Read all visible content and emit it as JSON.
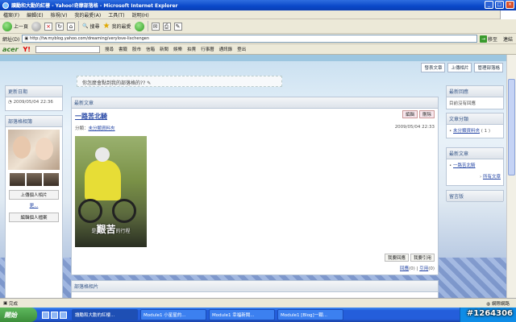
{
  "window": {
    "title": "讀勵和大勳的紅樓 - Yahoo!奇摩部落格 - Microsoft Internet Explorer",
    "min": "_",
    "max": "□",
    "close": "×"
  },
  "menu": [
    "檔案(F)",
    "編輯(E)",
    "檢視(V)",
    "我的最愛(A)",
    "工具(T)",
    "說明(H)"
  ],
  "toolbar": {
    "back": "上一頁",
    "search": "搜尋",
    "favorites": "我的最愛"
  },
  "address": {
    "label": "網址(D)",
    "url": "http://tw.myblog.yahoo.com/dreaming/verylove-lixchengen",
    "go": "移至",
    "links": "連結"
  },
  "ytoolbar": {
    "brand": "acer",
    "yahoo": "Y!",
    "items": [
      "搜尋",
      "書籤",
      "股市",
      "信箱",
      "新聞",
      "娛樂",
      "拍賣",
      "行事曆",
      "通訊錄",
      "登出"
    ]
  },
  "top_buttons": [
    "發表文章",
    "上傳相片",
    "管理部落格"
  ],
  "ask_text": "你怎麼會點到我的部落格的??",
  "left": {
    "updated_title": "更新日期",
    "updated_date": "2009/05/04 22:36",
    "members_title": "部落格相簿",
    "upload_btn": "上傳個人相片",
    "more": "更...",
    "edit_btn": "編輯個人檔案"
  },
  "main": {
    "header": "最新文章",
    "article_title": "一路苦北騎",
    "edit": "編輯",
    "delete": "刪除",
    "category_label": "分類：",
    "category": "未分類資料夾",
    "date": "2009/05/04 22:33",
    "caption_pre": "是",
    "caption_big": "艱苦",
    "caption_post": "的行程",
    "recommend": "我要回應",
    "quote": "我要引用",
    "stat_reply": "回應",
    "stat_reply_count": "(0)",
    "stat_quote": "引用",
    "stat_quote_count": "(0)"
  },
  "bottom_panel": "部落格相片",
  "right": {
    "p1_title": "最新回應",
    "p1_body": "目前沒有回應",
    "p2_title": "文章分類",
    "p2_item": "未分類資料夾",
    "p2_count": "( 1 )",
    "p3_title": "最新文章",
    "p3_item": "一路苦北騎",
    "p3_more": "所有文章",
    "p4_title": "留言版"
  },
  "status": {
    "text": "完成",
    "zone": "網際網路"
  },
  "taskbar": {
    "start": "開始",
    "tasks": [
      "讀勵和大勳的紅樓...",
      "Module1 小星星的...",
      "Module1 幸福新聞...",
      "Module1 [Blog]一顆..."
    ]
  },
  "watermark": "#1264306"
}
